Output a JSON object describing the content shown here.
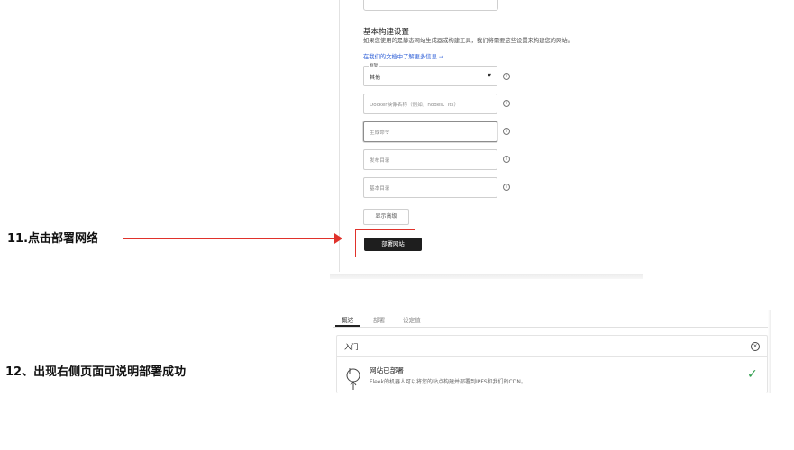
{
  "step11": {
    "label": "11.点击部署网络"
  },
  "step12": {
    "label": "12、出现右侧页面可说明部署成功"
  },
  "build_settings": {
    "title": "基本构建设置",
    "description": "如果您使用的是静态网站生成器或构建工具，我们将需要这些设置来构建您的网站。",
    "learn_more_link": "在我们的文档中了解更多信息 →",
    "framework": {
      "label": "框架",
      "value": "其他"
    },
    "docker_image": {
      "placeholder": "Docker映像名称（例如，nodes：lts）"
    },
    "build_command": {
      "placeholder": "生成命令"
    },
    "publish_dir": {
      "placeholder": "发布目录"
    },
    "base_dir": {
      "placeholder": "基本目录"
    },
    "info_icon": "info-icon",
    "show_advanced": "显示高级",
    "deploy_button": "部署网站"
  },
  "overview": {
    "tabs": [
      {
        "label": "概述",
        "active": true
      },
      {
        "label": "部署",
        "active": false
      },
      {
        "label": "设定值",
        "active": false
      }
    ],
    "card_title": "入门",
    "row_title": "网站已部署",
    "row_desc": "Fleek的机器人可以将您的站点构建并部署到IPFS和我们的CDN。",
    "status_icon": "check-icon",
    "status_color": "#2e9d4c"
  },
  "colors": {
    "annotation": "#e0322b",
    "link": "#2e5fd7",
    "button": "#1e1e1e"
  }
}
